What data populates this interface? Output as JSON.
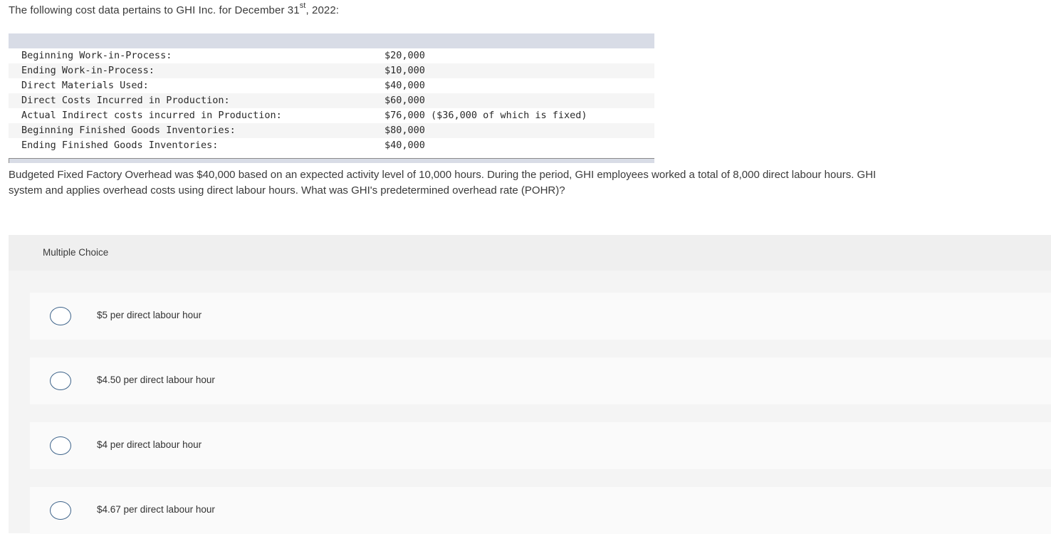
{
  "intro": {
    "text": "The following cost data pertains to GHI Inc. for December 31",
    "superscript": "st",
    "suffix": ", 2022:"
  },
  "cost_table": {
    "rows": [
      {
        "label": "Beginning Work-in-Process:",
        "value": "$20,000"
      },
      {
        "label": "Ending Work-in-Process:",
        "value": "$10,000"
      },
      {
        "label": "Direct Materials Used:",
        "value": "$40,000"
      },
      {
        "label": "Direct Costs Incurred in Production:",
        "value": "$60,000"
      },
      {
        "label": "Actual Indirect costs incurred in Production:",
        "value": "$76,000 ($36,000 of which is fixed)"
      },
      {
        "label": "Beginning Finished Goods Inventories:",
        "value": "$80,000"
      },
      {
        "label": "Ending Finished Goods Inventories:",
        "value": "$40,000"
      }
    ]
  },
  "question": {
    "line1": "Budgeted Fixed Factory Overhead was $40,000 based on an expected activity level of 10,000 hours. During the period, GHI employees worked a total of 8,000 direct labour hours. GHI",
    "line2": "system and applies overhead costs using direct labour hours. What was GHI's predetermined overhead rate (POHR)?"
  },
  "multiple_choice": {
    "title": "Multiple Choice",
    "options": [
      {
        "label": "$5 per direct labour hour",
        "selected": false
      },
      {
        "label": "$4.50 per direct labour hour",
        "selected": false
      },
      {
        "label": "$4 per direct labour hour",
        "selected": false
      },
      {
        "label": "$4.67 per direct labour hour",
        "selected": false
      }
    ]
  }
}
